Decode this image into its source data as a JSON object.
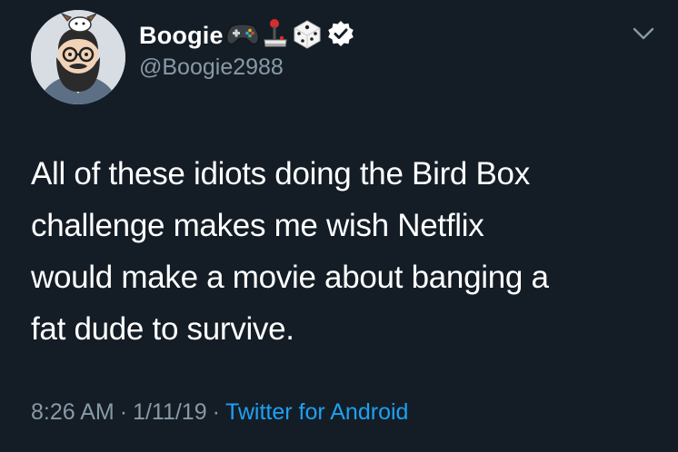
{
  "author": {
    "display_name": "Boogie",
    "handle": "@Boogie2988",
    "name_emojis": [
      "gamepad-icon",
      "joystick-icon",
      "dice-icon"
    ],
    "verified_icon": "verified-badge-icon",
    "avatar_icon": "avatar-illustration"
  },
  "menu": {
    "icon": "chevron-down-icon"
  },
  "tweet": {
    "text": "All of these idiots doing the Bird Box\nchallenge makes me wish Netflix\nwould make a movie about banging a\nfat dude to survive."
  },
  "meta": {
    "time": "8:26 AM",
    "separator": "·",
    "date": "1/11/19",
    "source": "Twitter for Android"
  },
  "colors": {
    "background": "#141d26",
    "text": "#ffffff",
    "secondary_text": "#8899a6",
    "link": "#1da1f2"
  }
}
